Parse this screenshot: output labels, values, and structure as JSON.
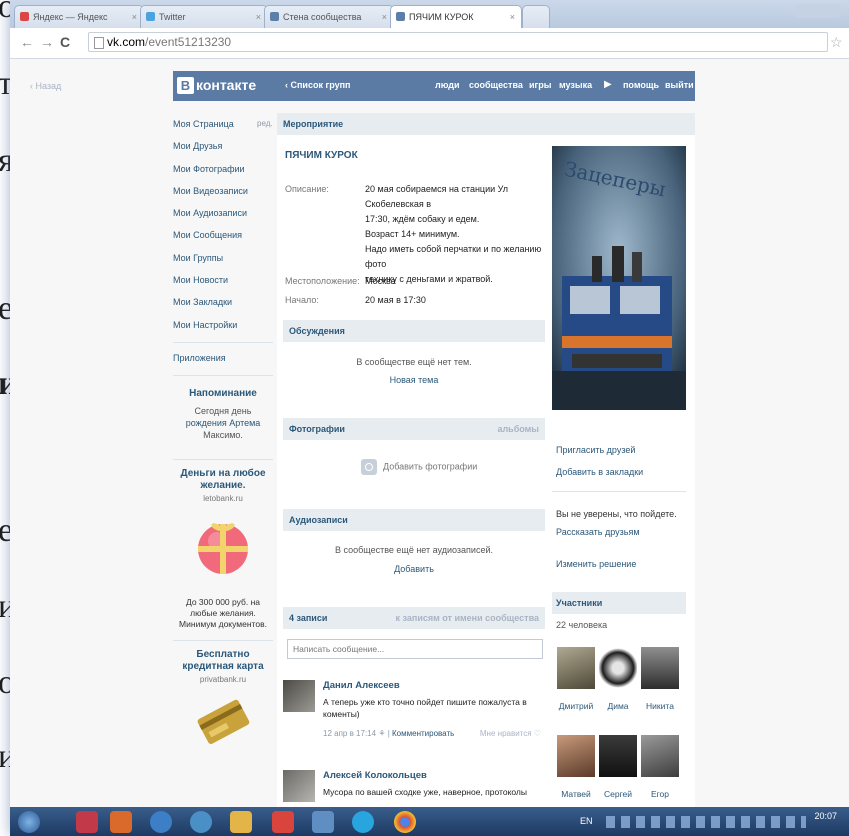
{
  "slide_letters": [
    "о",
    "т",
    "я",
    "е",
    "и",
    "е",
    "и",
    "о",
    "и"
  ],
  "browser": {
    "tabs": [
      {
        "label": "Яндекс — Яндекс",
        "active": false
      },
      {
        "label": "Twitter",
        "active": false
      },
      {
        "label": "Стена сообщества",
        "active": false
      },
      {
        "label": "ПЯЧИМ КУРОК",
        "active": true
      }
    ],
    "url_host": "vk.com",
    "url_path": "/event51213230"
  },
  "page": {
    "back": "Назад",
    "header": {
      "logo_letter": "В",
      "logo_text": "контакте",
      "group_list": "‹ Список групп",
      "nav": [
        "люди",
        "сообщества",
        "игры",
        "музыка",
        "помощь",
        "выйти"
      ]
    },
    "left_menu": {
      "items": [
        "Моя Страница",
        "Мои Друзья",
        "Мои Фотографии",
        "Мои Видеозаписи",
        "Мои Аудиозаписи",
        "Мои Сообщения",
        "Мои Группы",
        "Мои Новости",
        "Мои Закладки",
        "Мои Настройки"
      ],
      "edit": "ред.",
      "apps": "Приложения",
      "reminder_title": "Напоминание",
      "reminder_lines": [
        "Сегодня день",
        "рождения Артема",
        "Максимо."
      ],
      "ad1": {
        "title_lines": [
          "Деньги на любое",
          "желание."
        ],
        "site": "letobank.ru",
        "text_lines": [
          "До 300 000 руб. на",
          "любые желания.",
          "Минимум документов."
        ]
      },
      "ad2": {
        "title_lines": [
          "Бесплатно",
          "кредитная карта"
        ],
        "site": "privatbank.ru"
      }
    },
    "content": {
      "crumb": "Мероприятие",
      "title": "ПЯЧИМ КУРОК",
      "description_label": "Описание:",
      "description_lines": [
        "20 мая собираемся на станции Ул Скобелевская в",
        "17:30, ждём собаку и едем.",
        "Возраст 14+ минимум.",
        "Надо иметь собой перчатки и по желанию фото",
        "технику с деньгами и жратвой."
      ],
      "location_label": "Местоположение:",
      "location": "Москва",
      "start_label": "Начало:",
      "start": "20 мая в 17:30",
      "discussions": {
        "title": "Обсуждения",
        "empty": "В сообществе ещё нет тем.",
        "link": "Новая тема"
      },
      "photos": {
        "title": "Фотографии",
        "right": "альбомы",
        "add": "Добавить фотографии"
      },
      "audio": {
        "title": "Аудиозаписи",
        "empty": "В сообществе ещё нет аудиозаписей.",
        "link": "Добавить"
      },
      "wall": {
        "title": "4 записи",
        "right": "к записям от имени сообщества",
        "placeholder": "Написать сообщение..."
      },
      "posts": [
        {
          "author": "Данил Алексеев",
          "text_lines": [
            "А теперь уже кто точно пойдет пишите пожалуста в",
            "коменты)"
          ],
          "time": "12 апр в 17:14",
          "comment": "Комментировать",
          "like": "Мне нравится"
        },
        {
          "author": "Алексей Колокольцев",
          "text_lines": [
            "Мусора по вашей сходке уже, наверное, протоколы"
          ]
        }
      ]
    },
    "right_col": {
      "photo_caption": "Зацеперы",
      "invite": "Пригласить друзей",
      "bookmark": "Добавить в закладки",
      "unsure": "Вы не уверены, что пойдете.",
      "tell": "Рассказать друзьям",
      "change": "Изменить решение",
      "members_title": "Участники",
      "members_count": "22 человека",
      "members": [
        "Дмитрий",
        "Дима",
        "Никита",
        "Матвей",
        "Сергей",
        "Егор"
      ]
    }
  },
  "taskbar": {
    "lang": "EN",
    "time": "20:07"
  }
}
